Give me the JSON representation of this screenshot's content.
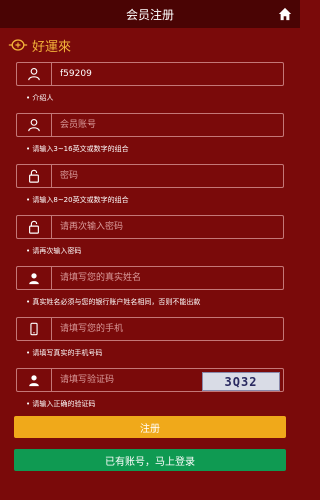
{
  "header": {
    "title": "会员注册",
    "home_icon": "home-icon"
  },
  "brand": {
    "text": "好運來",
    "color": "#f3b23a"
  },
  "form": {
    "username": {
      "value": "f59209",
      "placeholder": "",
      "hint": "介绍人"
    },
    "account": {
      "value": "",
      "placeholder": "会员账号",
      "hint": "请输入3~16英文或数字的组合"
    },
    "password": {
      "value": "",
      "placeholder": "密码",
      "hint": "请输入8~20英文或数字的组合"
    },
    "password_confirm": {
      "value": "",
      "placeholder": "请再次输入密码",
      "hint": "请再次输入密码"
    },
    "real_name": {
      "value": "",
      "placeholder": "请填写您的真实姓名",
      "hint": "真实姓名必须与您的银行账户姓名相同，否则不能出款"
    },
    "phone": {
      "value": "",
      "placeholder": "请填写您的手机",
      "hint": "请填写真实的手机号码"
    },
    "captcha": {
      "value": "",
      "placeholder": "请填写验证码",
      "hint": "请输入正确的验证码",
      "captcha_text": "3Q32"
    }
  },
  "buttons": {
    "register": "注册",
    "login": "已有账号，马上登录"
  },
  "colors": {
    "background": "#7a0a0a",
    "header": "#4a0404",
    "register": "#f0a91a",
    "login": "#0f9a52"
  }
}
